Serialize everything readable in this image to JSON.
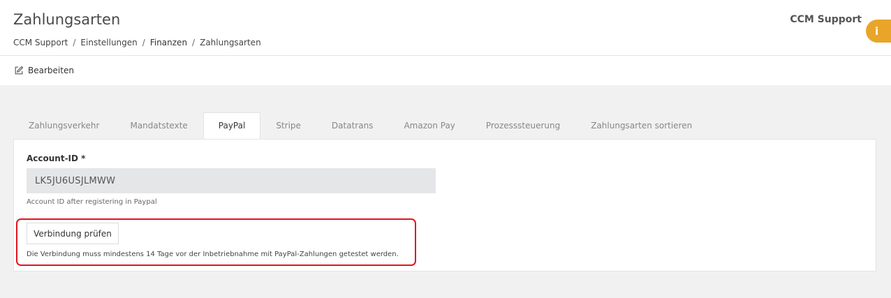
{
  "header": {
    "title": "Zahlungsarten",
    "breadcrumb": [
      "CCM Support",
      "Einstellungen",
      "Finanzen",
      "Zahlungsarten"
    ],
    "breadcrumb_sep": "/",
    "user": "CCM Support",
    "info_badge": "i",
    "accent_color": "#e8a52a"
  },
  "toolbar": {
    "edit_label": "Bearbeiten",
    "edit_icon": "pencil-square-icon"
  },
  "tabs": [
    {
      "label": "Zahlungsverkehr",
      "active": false
    },
    {
      "label": "Mandatstexte",
      "active": false
    },
    {
      "label": "PayPal",
      "active": true
    },
    {
      "label": "Stripe",
      "active": false
    },
    {
      "label": "Datatrans",
      "active": false
    },
    {
      "label": "Amazon Pay",
      "active": false
    },
    {
      "label": "Prozesssteuerung",
      "active": false
    },
    {
      "label": "Zahlungsarten sortieren",
      "active": false
    }
  ],
  "form": {
    "account_label": "Account-ID *",
    "account_value": "LK5JU6USJLMWW",
    "account_help": "Account ID after registering in Paypal",
    "check_button": "Verbindung prüfen",
    "check_help": "Die Verbindung muss mindestens 14 Tage vor der Inbetriebnahme mit PayPal-Zahlungen getestet werden.",
    "highlight_color": "#e0141e"
  }
}
